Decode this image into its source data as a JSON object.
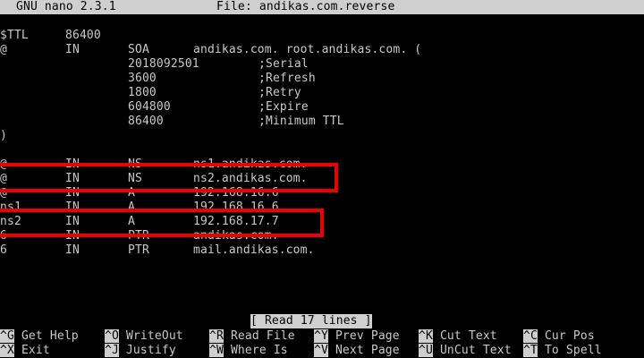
{
  "titlebar": {
    "app": "GNU nano 2.3.1",
    "file": "File: andikas.com.reverse"
  },
  "editor_lines": [
    [
      "$TTL",
      "86400",
      "",
      "",
      ""
    ],
    [
      "@",
      "IN",
      "SOA",
      "andikas.com. root.andikas.com. (",
      ""
    ],
    [
      "",
      "",
      "2018092501",
      "",
      ";Serial"
    ],
    [
      "",
      "",
      "3600",
      "",
      ";Refresh"
    ],
    [
      "",
      "",
      "1800",
      "",
      ";Retry"
    ],
    [
      "",
      "",
      "604800",
      "",
      ";Expire"
    ],
    [
      "",
      "",
      "86400",
      "",
      ";Minimum TTL"
    ],
    [
      ")",
      "",
      "",
      "",
      ""
    ],
    [
      "",
      "",
      "",
      "",
      ""
    ],
    [
      "@",
      "IN",
      "NS",
      "ns1.andikas.com.",
      ""
    ],
    [
      "@",
      "IN",
      "NS",
      "ns2.andikas.com.",
      ""
    ],
    [
      "@",
      "IN",
      "A",
      "192.168.16.6",
      ""
    ],
    [
      "ns1",
      "IN",
      "A",
      "192.168.16.6",
      ""
    ],
    [
      "ns2",
      "IN",
      "A",
      "192.168.17.7",
      ""
    ],
    [
      "6",
      "IN",
      "PTR",
      "andikas.com.",
      ""
    ],
    [
      "6",
      "IN",
      "PTR",
      "mail.andikas.com.",
      ""
    ]
  ],
  "status": "[ Read 17 lines ]",
  "shortcuts_row1": [
    {
      "key": "^G",
      "label": "Get Help"
    },
    {
      "key": "^O",
      "label": "WriteOut"
    },
    {
      "key": "^R",
      "label": "Read File"
    },
    {
      "key": "^Y",
      "label": "Prev Page"
    },
    {
      "key": "^K",
      "label": "Cut Text"
    },
    {
      "key": "^C",
      "label": "Cur Pos"
    }
  ],
  "shortcuts_row2": [
    {
      "key": "^X",
      "label": "Exit"
    },
    {
      "key": "^J",
      "label": "Justify"
    },
    {
      "key": "^W",
      "label": "Where Is"
    },
    {
      "key": "^V",
      "label": "Next Page"
    },
    {
      "key": "^U",
      "label": "UnCut Text"
    },
    {
      "key": "^T",
      "label": "To Spell"
    }
  ],
  "colors": {
    "background": "#000000",
    "text": "#c8c8c8",
    "inverse_bg": "#cfcfcf",
    "highlight": "#ee0000"
  }
}
